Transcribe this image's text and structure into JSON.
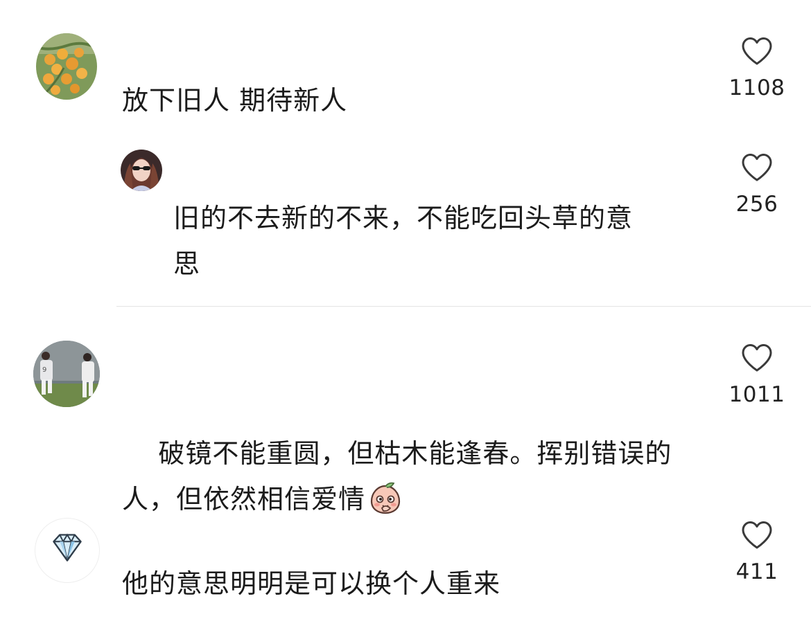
{
  "comments": [
    {
      "text": "放下旧人 期待新人",
      "likes": "1108",
      "avatar": "oranges-tree-avatar"
    },
    {
      "text": "旧的不去新的不来，不能吃回头草的意\n思",
      "likes": "256",
      "avatar": "woman-sunglasses-avatar",
      "is_reply": true
    },
    {
      "text": "破镜不能重圆，但枯木能逢春。挥别错误的\n人，但依然相信爱情",
      "likes": "1011",
      "avatar": "football-players-avatar",
      "emoji": "peach-shy-emoji"
    },
    {
      "text": "他的意思明明是可以换个人重来",
      "likes": "411",
      "avatar": "diamond-avatar"
    }
  ],
  "icons": {
    "like": "heart-outline-icon"
  },
  "colors": {
    "text": "#1b1b1b",
    "divider": "#e4e4e4",
    "heart_stroke": "#3a3a3a"
  }
}
